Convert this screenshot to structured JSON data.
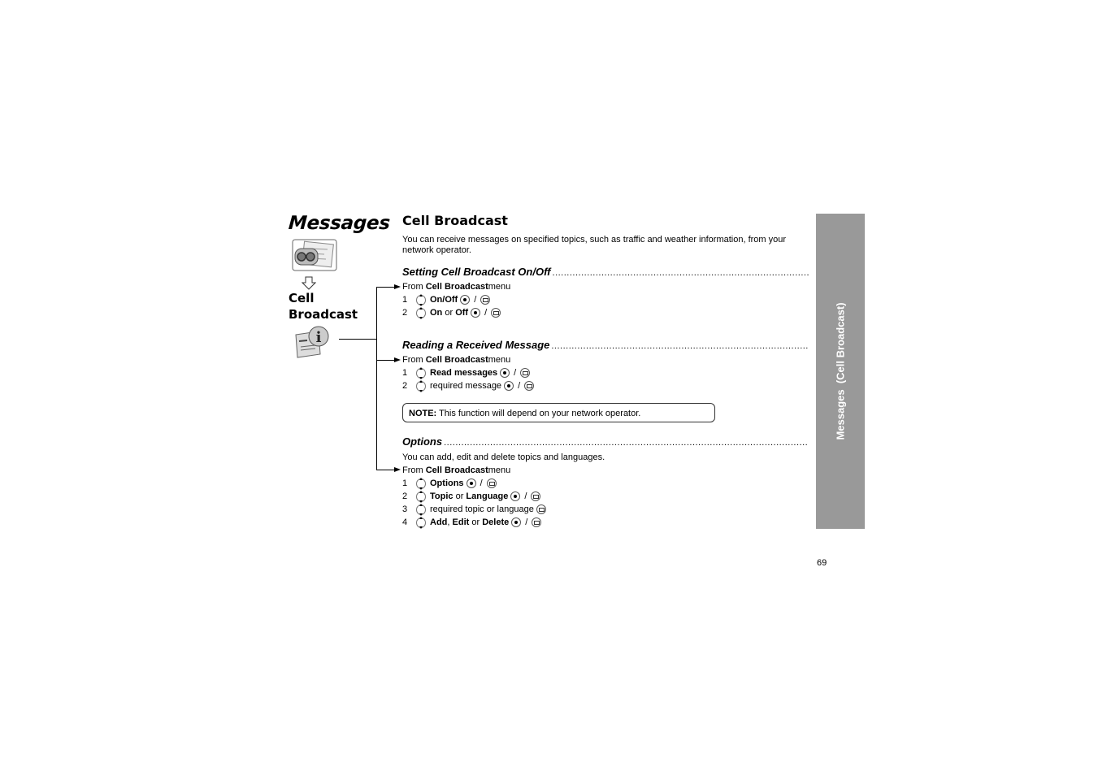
{
  "left_panel": {
    "title": "Messages",
    "menu_path_arrow": "down-arrow-outline",
    "submenu_title_line1": "Cell",
    "submenu_title_line2": "Broadcast",
    "icons": [
      "messages-icon",
      "cell-broadcast-info-icon"
    ]
  },
  "section": {
    "title": "Cell Broadcast",
    "intro": "You can receive messages on specified topics, such as traffic and weather information, from your network operator."
  },
  "subsections": [
    {
      "heading": "Setting Cell Broadcast On/Off",
      "from_prefix": "From ",
      "from_bold": "Cell Broadcast",
      "from_suffix": " menu",
      "steps": [
        {
          "num": "1",
          "parts": [
            {
              "b": "On/Off"
            }
          ],
          "keys": [
            "ok",
            "soft"
          ]
        },
        {
          "num": "2",
          "parts": [
            {
              "b": "On"
            },
            {
              "t": " or "
            },
            {
              "b": "Off"
            }
          ],
          "keys": [
            "ok",
            "soft"
          ]
        }
      ]
    },
    {
      "heading": "Reading a Received Message",
      "from_prefix": "From ",
      "from_bold": "Cell Broadcast",
      "from_suffix": " menu",
      "steps": [
        {
          "num": "1",
          "parts": [
            {
              "b": "Read messages"
            }
          ],
          "keys": [
            "ok",
            "soft"
          ]
        },
        {
          "num": "2",
          "parts": [
            {
              "t": "required message"
            }
          ],
          "keys": [
            "ok",
            "soft"
          ]
        }
      ],
      "note_label": "NOTE:",
      "note_text": " This function will depend on your network operator."
    },
    {
      "heading": "Options",
      "intro": "You can add, edit and delete topics and languages.",
      "from_prefix": "From ",
      "from_bold": "Cell Broadcast",
      "from_suffix": " menu",
      "steps": [
        {
          "num": "1",
          "parts": [
            {
              "b": "Options"
            }
          ],
          "keys": [
            "ok",
            "soft"
          ]
        },
        {
          "num": "2",
          "parts": [
            {
              "b": "Topic"
            },
            {
              "t": " or "
            },
            {
              "b": "Language"
            }
          ],
          "keys": [
            "ok",
            "soft"
          ]
        },
        {
          "num": "3",
          "parts": [
            {
              "t": "required topic or language"
            }
          ],
          "keys": [
            "soft"
          ]
        },
        {
          "num": "4",
          "parts": [
            {
              "b": "Add"
            },
            {
              "t": ", "
            },
            {
              "b": "Edit"
            },
            {
              "t": " or "
            },
            {
              "b": "Delete"
            }
          ],
          "keys": [
            "ok",
            "soft"
          ]
        }
      ]
    }
  ],
  "key_separator": "/",
  "dots": "..................................................................................................................................................................",
  "sidebar": {
    "label": "Messages  (Cell Broadcast)",
    "color": "#999999"
  },
  "page_number": "69"
}
